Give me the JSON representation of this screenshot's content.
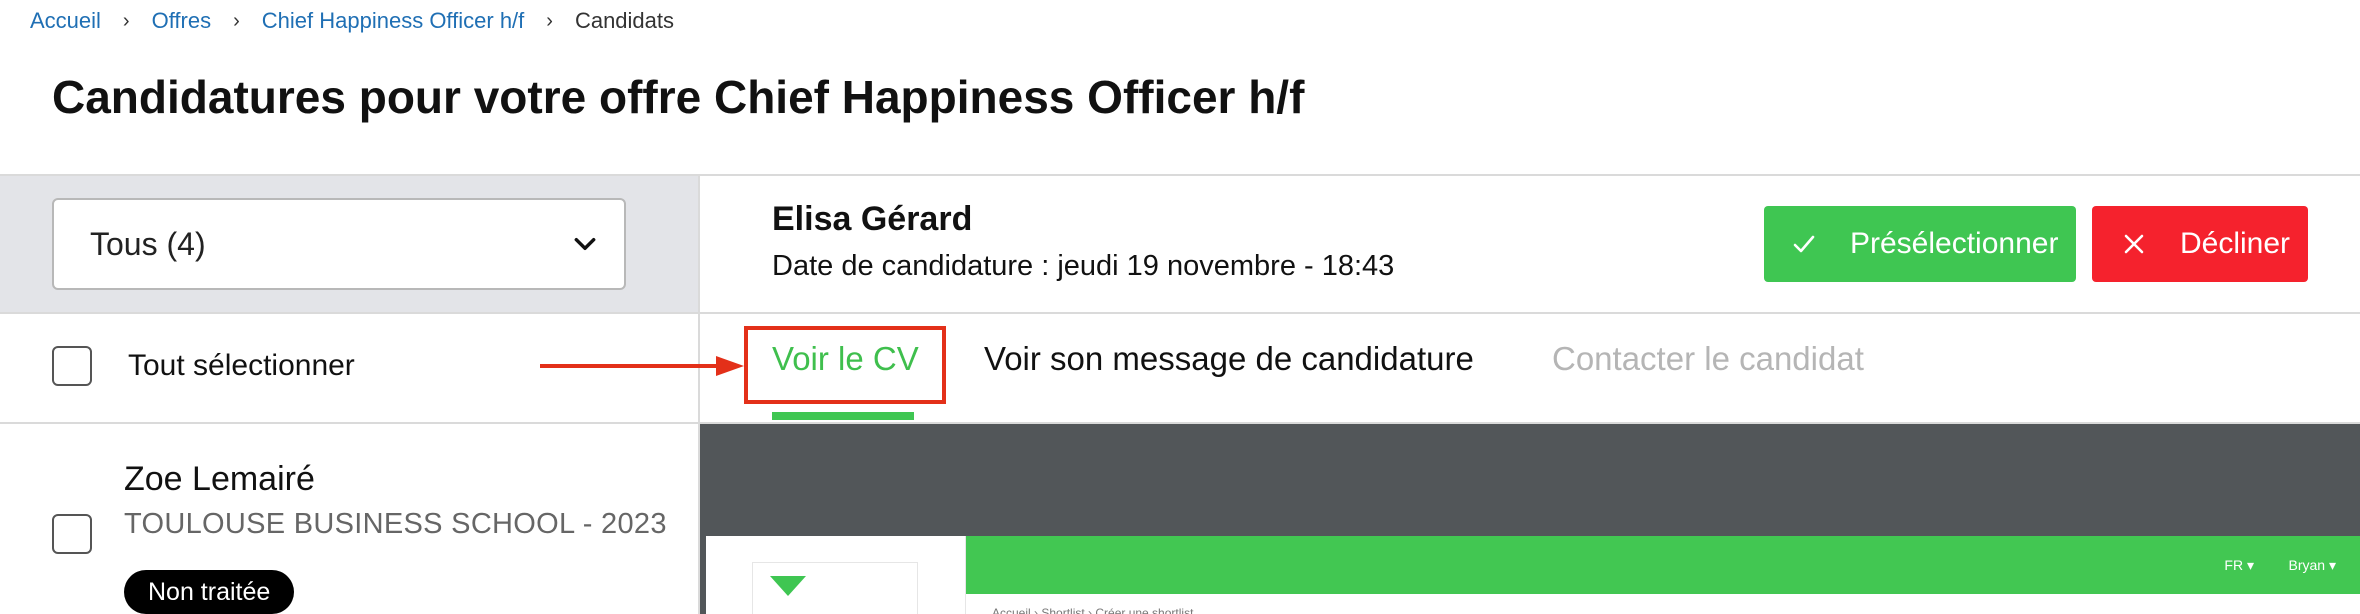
{
  "breadcrumb": {
    "home": "Accueil",
    "offers": "Offres",
    "offer": "Chief Happiness Officer h/f",
    "current": "Candidats"
  },
  "page": {
    "title": "Candidatures pour votre offre Chief Happiness Officer h/f"
  },
  "filter": {
    "selected": "Tous (4)"
  },
  "list": {
    "select_all": "Tout sélectionner",
    "candidates": [
      {
        "name": "Zoe Lemairé",
        "school": "TOULOUSE BUSINESS SCHOOL - 2023",
        "status": "Non traitée"
      }
    ]
  },
  "applicant": {
    "name": "Elisa Gérard",
    "date": "Date de candidature : jeudi 19 novembre - 18:43"
  },
  "actions": {
    "preselect": "Présélectionner",
    "decline": "Décliner"
  },
  "tabs": {
    "cv": "Voir le CV",
    "message": "Voir son message de candidature",
    "contact": "Contacter le candidat"
  },
  "cv_preview": {
    "lang": "FR ▾",
    "user": "Bryan ▾",
    "breadcrumb": "Accueil  ›  Shortlist  ›  Créer une shortlist"
  },
  "colors": {
    "accent_green": "#3fc652",
    "decline_red": "#f5222d",
    "link_blue": "#1f6fb4",
    "highlight_red": "#e33019"
  }
}
